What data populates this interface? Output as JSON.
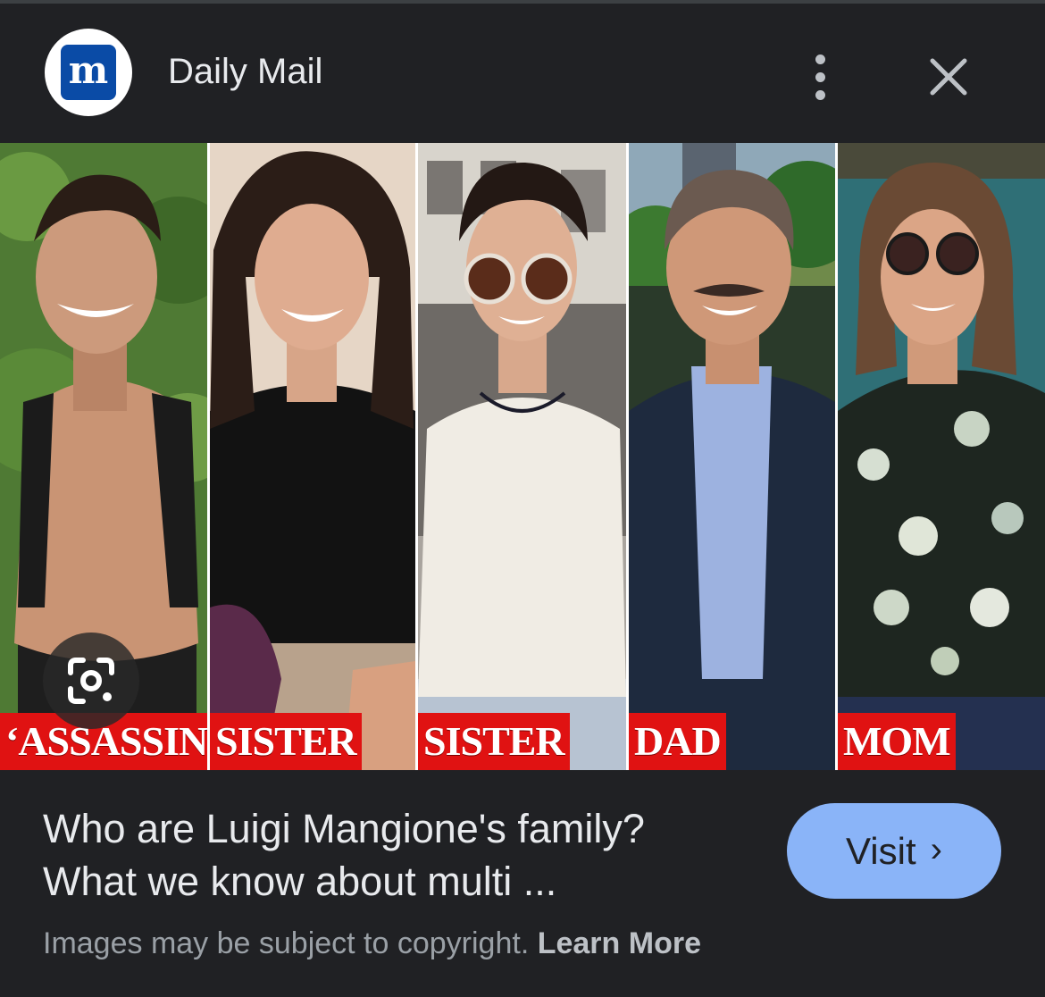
{
  "header": {
    "site_name": "Daily Mail",
    "logo_letter": "m",
    "more_icon": "more-vert-icon",
    "close_icon": "close-icon"
  },
  "image": {
    "panels": [
      {
        "label": "‘ASSASSIN’"
      },
      {
        "label": "SISTER"
      },
      {
        "label": "SISTER"
      },
      {
        "label": "DAD"
      },
      {
        "label": "MOM"
      }
    ],
    "lens_icon": "google-lens-icon"
  },
  "caption": {
    "line1": "Who are Luigi Mangione's family?",
    "line2": "What we know about multi ..."
  },
  "visit": {
    "label": "Visit",
    "chevron": "›"
  },
  "notice": {
    "text": "Images may be subject to copyright.",
    "link": "Learn More"
  },
  "colors": {
    "background": "#202124",
    "accent": "#8ab4f8",
    "label_red": "#e01212",
    "logo_blue": "#0a4ba6"
  }
}
